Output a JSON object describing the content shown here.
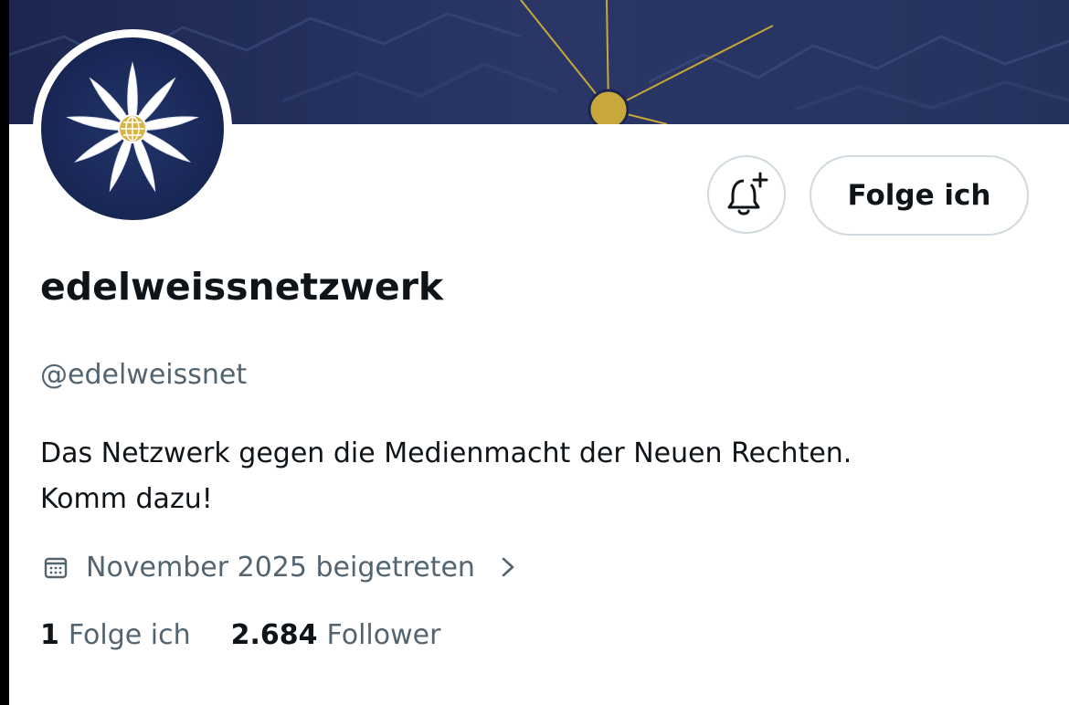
{
  "profile": {
    "display_name": "edelweissnetzwerk",
    "handle": "@edelweissnet",
    "bio_lines": [
      "Das Netzwerk gegen die Medienmacht der Neuen Rechten.",
      "Komm dazu!"
    ],
    "joined": "November 2025 beigetreten",
    "stats": {
      "following_count": "1",
      "following_label": "Folge ich",
      "followers_count": "2.684",
      "followers_label": "Follower"
    }
  },
  "actions": {
    "follow_button_label": "Folge ich",
    "bell_icon": "bell-plus-icon"
  },
  "icons": {
    "calendar": "calendar-icon",
    "chevron": "chevron-right-icon",
    "avatar_logo": "edelweiss-flower-icon"
  },
  "colors": {
    "banner": "#1f2a52",
    "avatar_bg": "#182654",
    "accent_gold": "#c8a83a",
    "text_primary": "#0f1419",
    "text_secondary": "#536471",
    "border": "#cfd9de"
  }
}
